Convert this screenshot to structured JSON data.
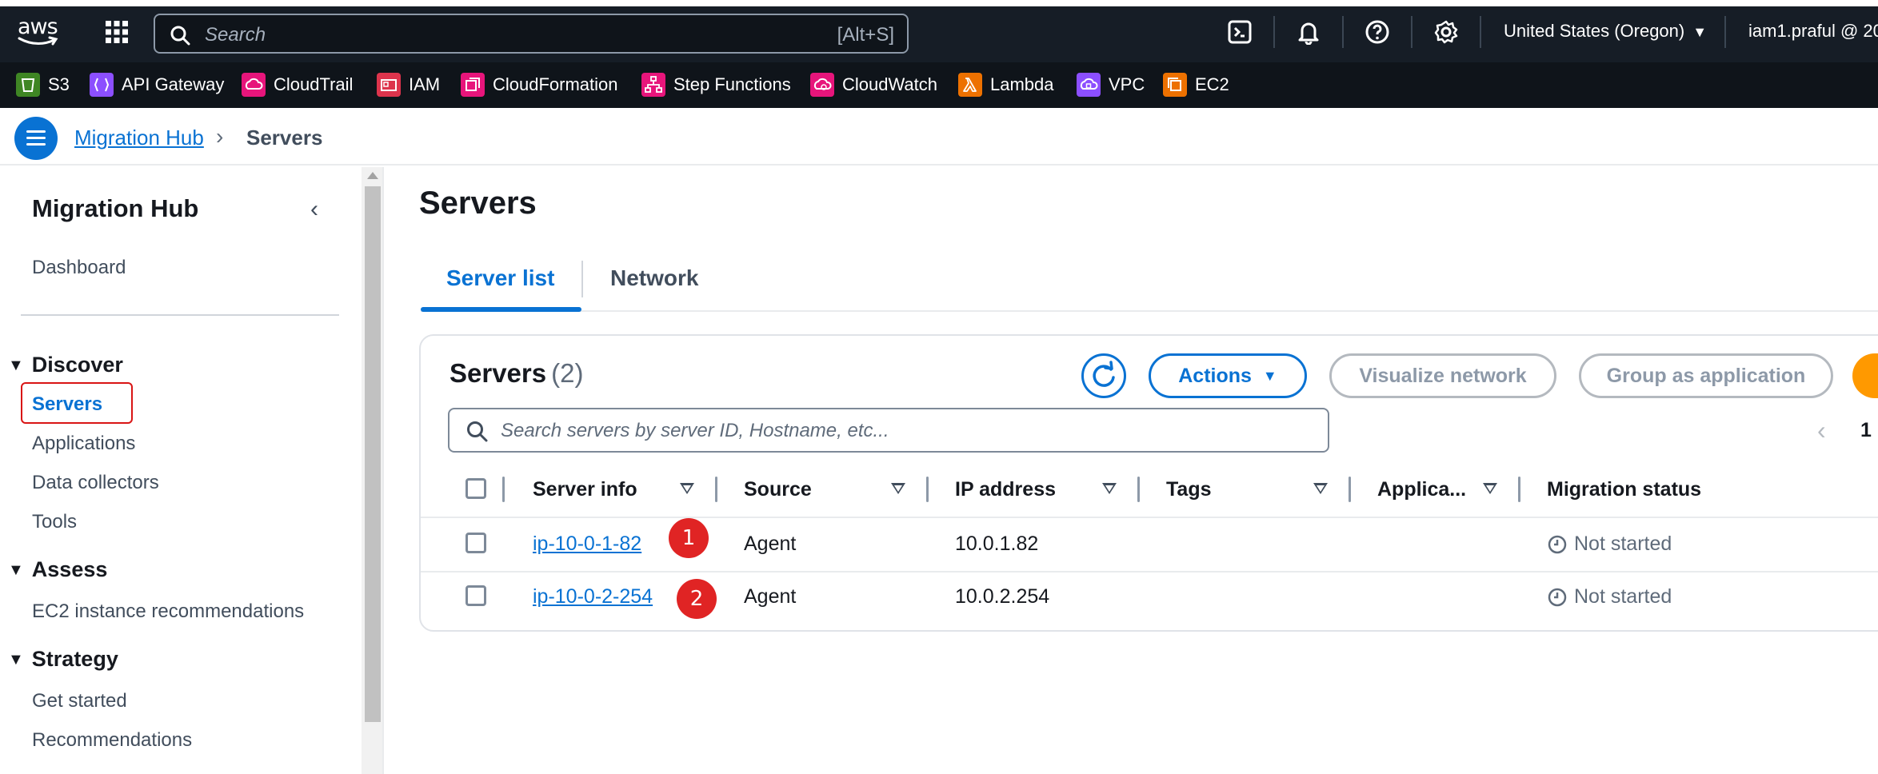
{
  "topnav": {
    "logo_text": "aws",
    "search_placeholder": "Search",
    "search_shortcut": "[Alt+S]",
    "region": "United States (Oregon)",
    "user": "iam1.praful @ 20"
  },
  "favorites": [
    {
      "label": "S3",
      "color": "#3f8624"
    },
    {
      "label": "API Gateway",
      "color": "#8c4fff"
    },
    {
      "label": "CloudTrail",
      "color": "#e7157b"
    },
    {
      "label": "IAM",
      "color": "#dd344c"
    },
    {
      "label": "CloudFormation",
      "color": "#e7157b"
    },
    {
      "label": "Step Functions",
      "color": "#e7157b"
    },
    {
      "label": "CloudWatch",
      "color": "#e7157b"
    },
    {
      "label": "Lambda",
      "color": "#ed7100"
    },
    {
      "label": "VPC",
      "color": "#8c4fff"
    },
    {
      "label": "EC2",
      "color": "#ed7100"
    }
  ],
  "breadcrumb": {
    "parent": "Migration Hub",
    "current": "Servers"
  },
  "sidenav": {
    "title": "Migration Hub",
    "dashboard": "Dashboard",
    "sections": [
      {
        "title": "Discover",
        "items": [
          "Servers",
          "Applications",
          "Data collectors",
          "Tools"
        ]
      },
      {
        "title": "Assess",
        "items": [
          "EC2 instance recommendations"
        ]
      },
      {
        "title": "Strategy",
        "items": [
          "Get started",
          "Recommendations"
        ]
      }
    ]
  },
  "main": {
    "title": "Servers",
    "tabs": [
      "Server list",
      "Network"
    ],
    "container": {
      "title": "Servers",
      "count": "(2)",
      "actions_label": "Actions",
      "visualize_label": "Visualize network",
      "group_label": "Group as application",
      "search_placeholder": "Search servers by server ID, Hostname, etc...",
      "page_number": "1",
      "columns": [
        "Server info",
        "Source",
        "IP address",
        "Tags",
        "Applica...",
        "Migration status"
      ],
      "rows": [
        {
          "server": "ip-10-0-1-82",
          "source": "Agent",
          "ip": "10.0.1.82",
          "tags": "",
          "app": "",
          "status": "Not started",
          "badge": "1"
        },
        {
          "server": "ip-10-0-2-254",
          "source": "Agent",
          "ip": "10.0.2.254",
          "tags": "",
          "app": "",
          "status": "Not started",
          "badge": "2"
        }
      ]
    }
  },
  "colors": {
    "accent": "#0972d3",
    "highlight_box": "#d91515",
    "badge": "#e02424",
    "orange": "#ff9900"
  }
}
